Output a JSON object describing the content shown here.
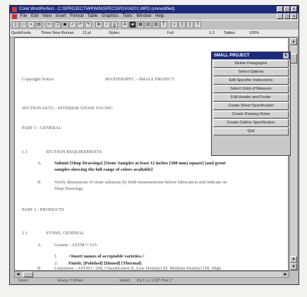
{
  "window": {
    "title": "Corel WordPerfect - C:\\SPROJECT\\WPWIN\\SPEC\\SPDV04201.WPD (unmodified)"
  },
  "menu": [
    "File",
    "Edit",
    "View",
    "Insert",
    "Format",
    "Table",
    "Graphics",
    "Tools",
    "Window",
    "Help"
  ],
  "propbar": {
    "quickfonts": "QuickFonts",
    "font": "Times New Roman",
    "size": "11 pt",
    "styles": "Styles",
    "justify": "Full",
    "spacing": "1.0",
    "tables": "Tables",
    "zoom": "100%"
  },
  "document": {
    "header_left": "Copyright Notice",
    "header_right": "MASTERSPEC - SMALL PROJECT",
    "section": "SECTION 04721 - INTERIOR STONE FACING",
    "part1": "PART 1 - GENERAL",
    "p11_num": "1.1",
    "p11": "SECTION REQUIREMENTS",
    "a_letter": "A.",
    "a_line1": "Submit [Shop Drawings] [Stone Samples at least 12 inches (300 mm) square] [and grout",
    "a_line2": "samples showing the full range of colors available]",
    "b_letter": "B.",
    "b_line1": "Verify dimensions of stone substrate by field measurements before fabrication and indicate on",
    "b_line2": "Shop Drawings",
    "part2": "PART 2 - PRODUCTS",
    "p21_num": "2.1",
    "p21": "STONE, GENERAL",
    "ga_letter": "A.",
    "ga_text": "Granite - ASTM C 615",
    "g1_num": "1.",
    "g1_text": "<Insert names of acceptable varieties.>",
    "g2_num": "2.",
    "g2_text": "Finish: [Polished] [Honed] [Thermal]",
    "gb_letter": "B.",
    "gb_text": "Limestone - ASTM C 568, Classification [I, Low Density] [II, Medium Density] [III, High"
  },
  "status": {
    "insert": "Insert",
    "printer": "Envoy 7 Driver",
    "select": "Select",
    "position": "Pg 1 Ln 1.03\" Pos 1\""
  },
  "panel": {
    "title": "SMALL PROJECT",
    "buttons": [
      "Delete Paragraphs",
      "Select Options",
      "Edit Specifier Instructions",
      "Select Units of Measure",
      "Edit Header and Footer",
      "Create Sheet Specification",
      "Create Drawing Notes",
      "Create Outline Specification",
      "Quit"
    ]
  }
}
